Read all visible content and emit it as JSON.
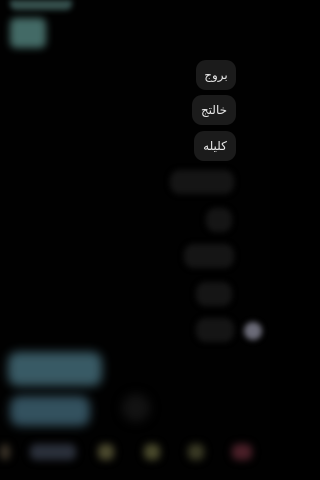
{
  "chat": {
    "messages": [
      {
        "text": "بروج",
        "side": "right"
      },
      {
        "text": "خالتج",
        "side": "right"
      },
      {
        "text": "كليله",
        "side": "right"
      }
    ]
  },
  "theme": {
    "background": "#010101",
    "bubble_color": "#1b1b1b",
    "text_color": "#e8e8e8",
    "accent_teal": "#3f6470"
  },
  "icons": {
    "avatar": "avatar-icon"
  }
}
